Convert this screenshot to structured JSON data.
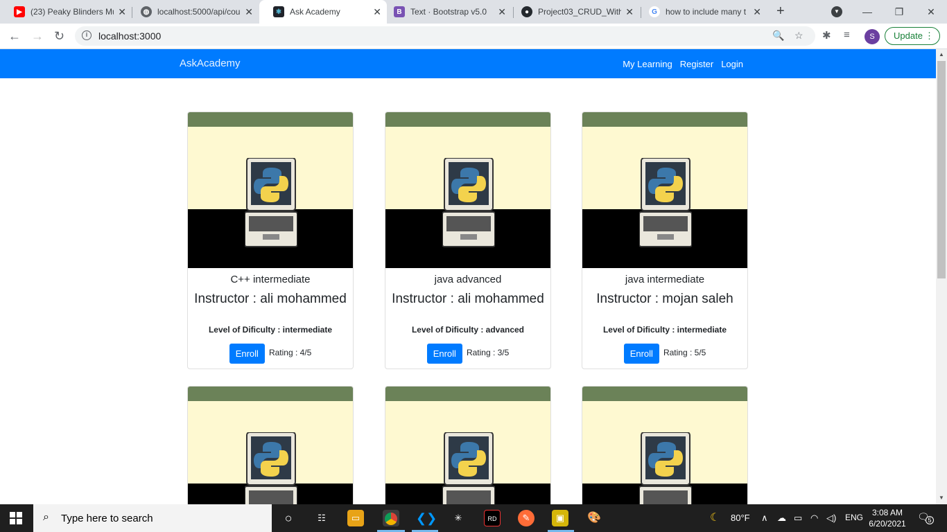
{
  "browser": {
    "tabs": [
      {
        "title": "(23) Peaky Blinders Mu",
        "icon": "youtube-icon",
        "color": "#ff0000"
      },
      {
        "title": "localhost:5000/api/cou",
        "icon": "globe-icon",
        "color": "#5f6368"
      },
      {
        "title": "Ask Academy",
        "icon": "react-icon",
        "color": "#20232a"
      },
      {
        "title": "Text · Bootstrap v5.0",
        "icon": "bootstrap-icon",
        "color": "#7952b3"
      },
      {
        "title": "Project03_CRUD_With",
        "icon": "github-icon",
        "color": "#24292e"
      },
      {
        "title": "how to include many t",
        "icon": "google-icon",
        "color": "#4285f4"
      }
    ],
    "url": "localhost:3000",
    "profile_initial": "S",
    "update_label": "Update"
  },
  "app": {
    "brand": "AskAcademy",
    "nav": {
      "my_learning": "My Learning",
      "register": "Register",
      "login": "Login"
    },
    "accent_color": "#007bff"
  },
  "courses": [
    {
      "title": "C++ intermediate",
      "instructor": "Instructor : ali mohammed",
      "level": "Level of Dificulty : intermediate",
      "enroll": "Enroll",
      "rating": "Rating : 4/5"
    },
    {
      "title": "java advanced",
      "instructor": "Instructor : ali mohammed",
      "level": "Level of Dificulty : advanced",
      "enroll": "Enroll",
      "rating": "Rating : 3/5"
    },
    {
      "title": "java intermediate",
      "instructor": "Instructor : mojan saleh",
      "level": "Level of Dificulty : intermediate",
      "enroll": "Enroll",
      "rating": "Rating : 5/5"
    }
  ],
  "taskbar": {
    "search_placeholder": "Type here to search",
    "weather": "80°F",
    "language": "ENG",
    "time": "3:08 AM",
    "date": "6/20/2021",
    "notification_count": "5"
  }
}
